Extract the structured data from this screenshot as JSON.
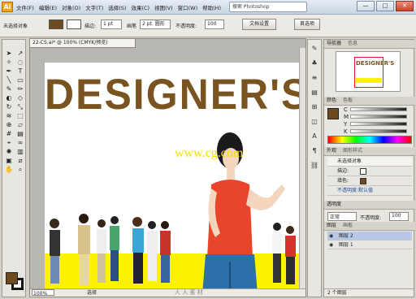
{
  "window": {
    "logo": "Ai",
    "menus": [
      "文件(F)",
      "编辑(E)",
      "对象(O)",
      "文字(T)",
      "选择(S)",
      "效果(C)",
      "视图(V)",
      "窗口(W)",
      "帮助(H)"
    ],
    "search": "搜索 Photoshop",
    "controls": [
      "—",
      "□",
      "✕"
    ]
  },
  "control_bar": {
    "label": "未选择对象",
    "fill_color": "#6e4a1f",
    "stroke_label": "描边:",
    "stroke_value": "1 pt",
    "brush_label": "画笔",
    "style_label": "2 pt. 圆形",
    "opacity_label": "不透明度:",
    "opacity_value": "100",
    "doc_setup_button": "文档设置",
    "prefs_button": "首选项"
  },
  "document": {
    "tab_title": "22-CS.ai* @ 100% (CMYK/预览)",
    "headline": "DESIGNER'S",
    "watermark": "www.cg.com",
    "zoom": "100%",
    "status": "选择",
    "status_watermark": "人 人 素 材",
    "headline_color": "#7a5420",
    "band_color": "#fdf300"
  },
  "panels": {
    "navigator_title": "导航器",
    "navigator_tab2": "信息",
    "navigator_thumb_text": "DESIGNER'S",
    "color_title": "颜色",
    "color_tab2": "色板",
    "color_rows": [
      "C",
      "M",
      "Y",
      "K"
    ],
    "appearance_title": "外观",
    "appearance_tab2": "图形样式",
    "appearance_rows": [
      "未选择对象",
      "描边:",
      "填色:",
      "不透明度:默认值"
    ],
    "transparency_title": "透明度",
    "transparency_mode": "正常",
    "transparency_opacity_label": "不透明度:",
    "transparency_opacity": "100",
    "layers_title": "图层",
    "layers_tab2": "画板",
    "layers": [
      "图层 2",
      "图层 1"
    ],
    "layers_footer": "2 个图层"
  }
}
